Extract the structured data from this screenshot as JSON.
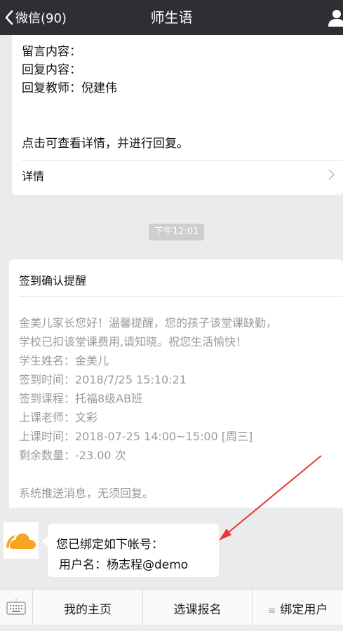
{
  "nav": {
    "back_label": "微信(90)",
    "title": "师生语"
  },
  "card1": {
    "lines": [
      "留言内容：",
      "回复内容：",
      "回复教师：倪建伟"
    ],
    "hint": "点击可查看详情，并进行回复。",
    "detail_label": "详情"
  },
  "time_label": "下午12:01",
  "card2": {
    "title": "签到确认提醒",
    "body_lines": [
      "金美儿家长您好！温馨提醒，您的孩子该堂课缺勤，",
      "学校已扣该堂课费用,请知晓。祝您生活愉快！",
      "学生姓名：金美儿",
      "签到时间：2018/7/25 15:10:21",
      "签到课程：托福8级AB班",
      "上课老师：文彩",
      "上课时间：2018-07-25 14:00~15:00  [周三]",
      "剩余数量：-23.00 次",
      "",
      "系统推送消息，无须回复。"
    ]
  },
  "message": {
    "line1": "您已绑定如下帐号：",
    "line2": "用户名：杨志程@demo"
  },
  "bottom_menu": {
    "items": [
      "我的主页",
      "选课报名",
      "绑定用户"
    ]
  },
  "colors": {
    "nav_bg": "#2e2e33",
    "page_bg": "#ebebeb",
    "annotation_arrow": "#e53935",
    "avatar_cloud": "#f5a623"
  }
}
